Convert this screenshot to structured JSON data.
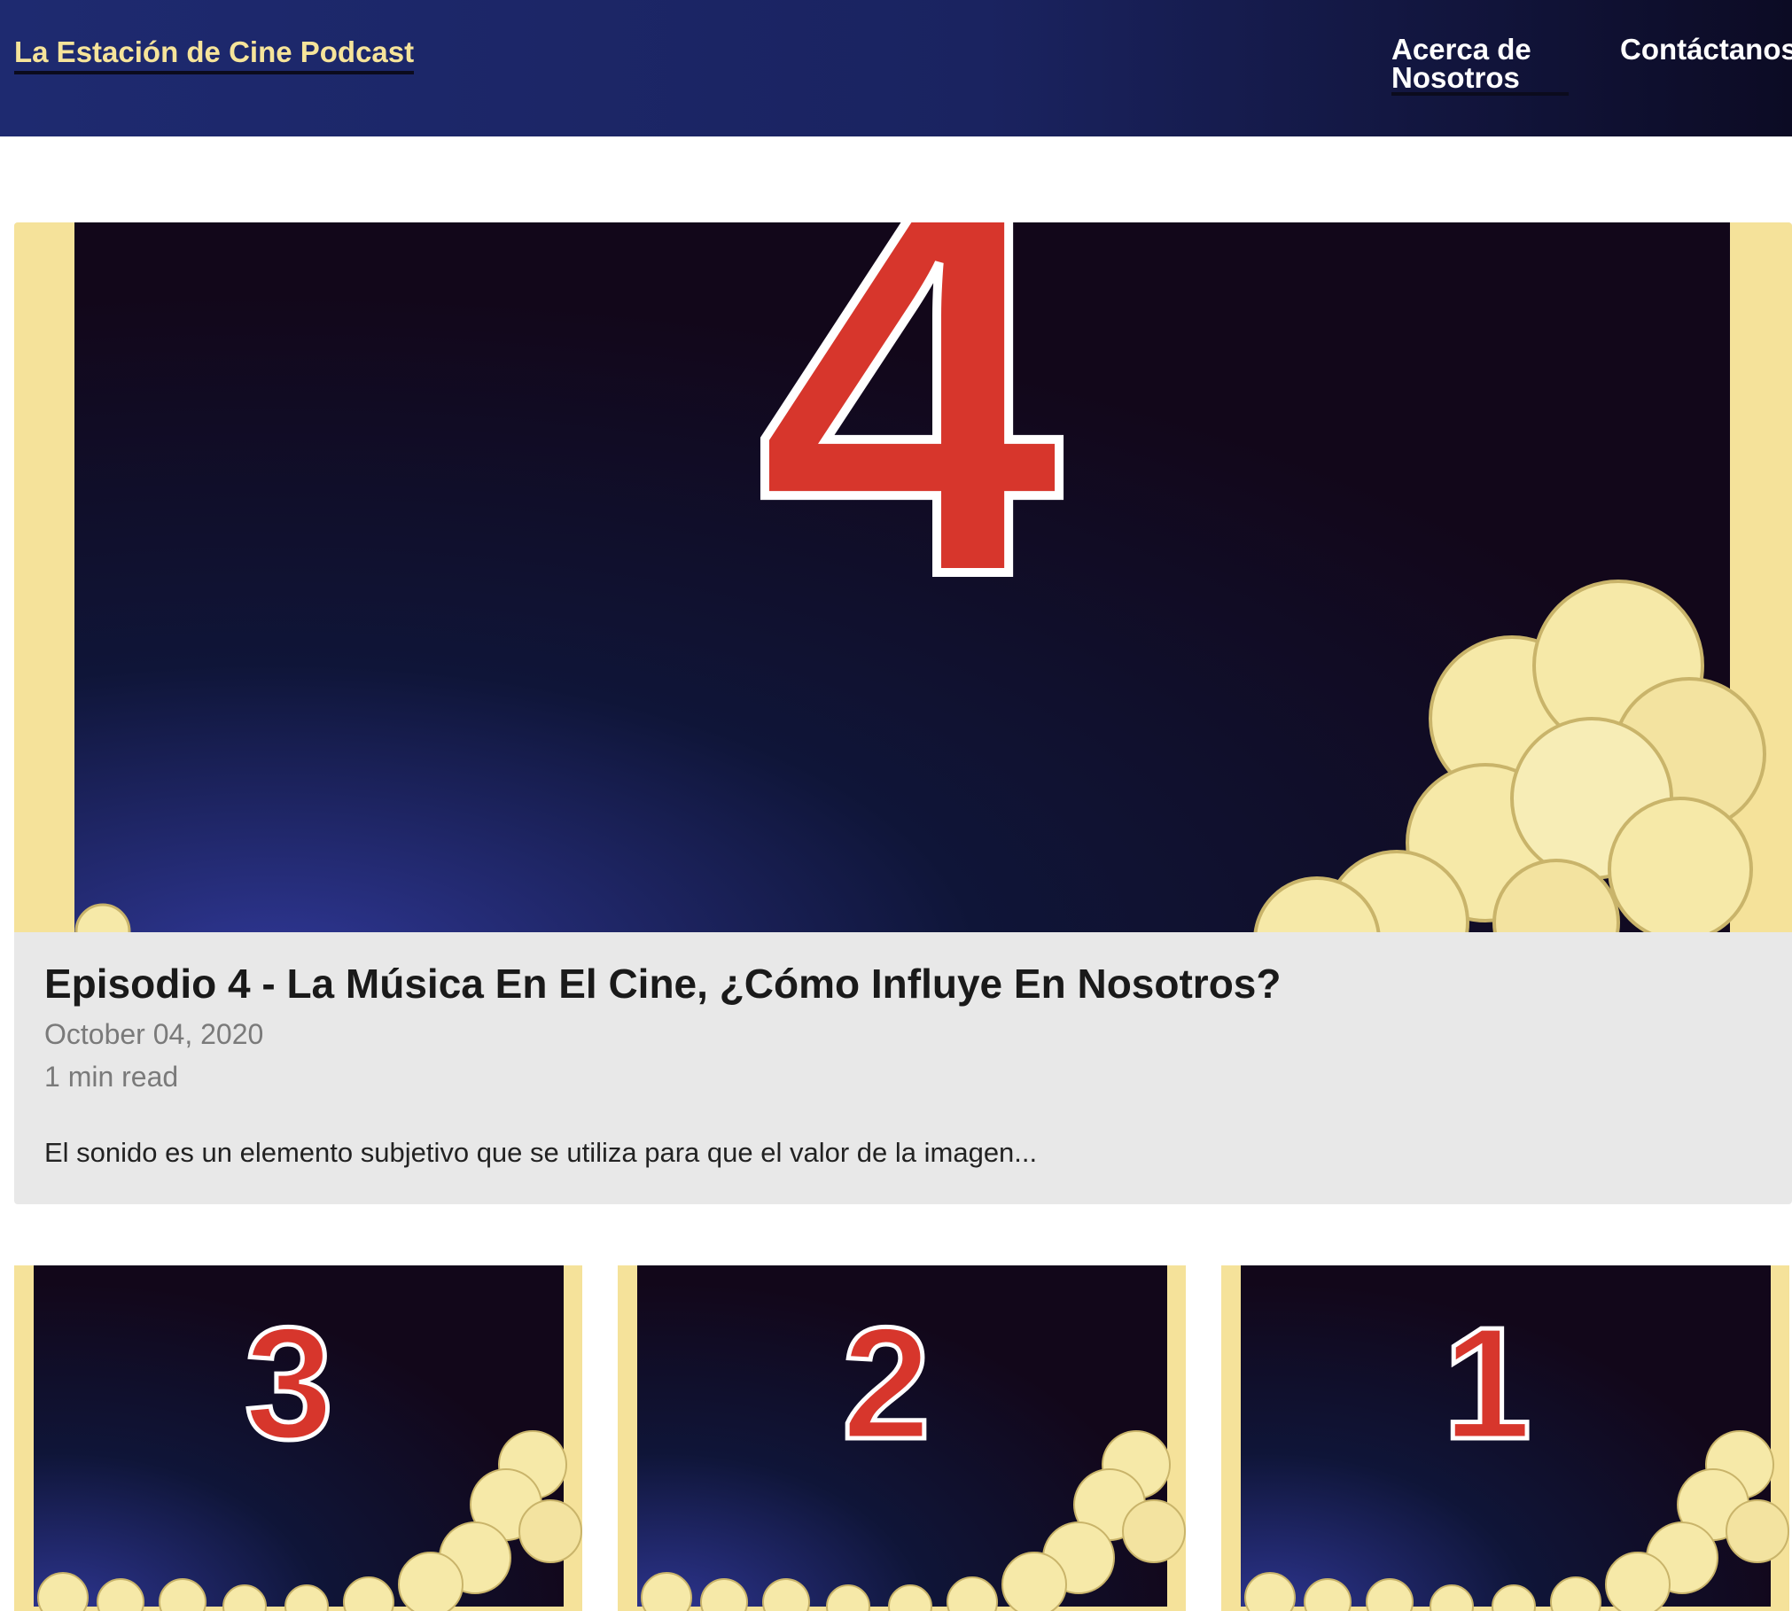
{
  "header": {
    "brand": "La Estación de Cine Podcast",
    "nav": [
      {
        "label": "Acerca de Nosotros"
      },
      {
        "label": "Contáctanos"
      }
    ]
  },
  "featured": {
    "episode_number": "4",
    "title": "Episodio 4 - La Música En El Cine, ¿Cómo Influye En Nosotros?",
    "date": "October 04, 2020",
    "read_time": "1 min read",
    "excerpt": "El sonido es un elemento subjetivo que se utiliza para que el valor de la imagen..."
  },
  "cards": [
    {
      "episode_number": "3"
    },
    {
      "episode_number": "2"
    },
    {
      "episode_number": "1"
    }
  ],
  "colors": {
    "header_start": "#1e2a70",
    "header_end": "#0c0b24",
    "brand": "#f6e49a",
    "number_red": "#d7362c",
    "popcorn": "#f6e9a8",
    "frame_yellow": "#f5e29a"
  }
}
